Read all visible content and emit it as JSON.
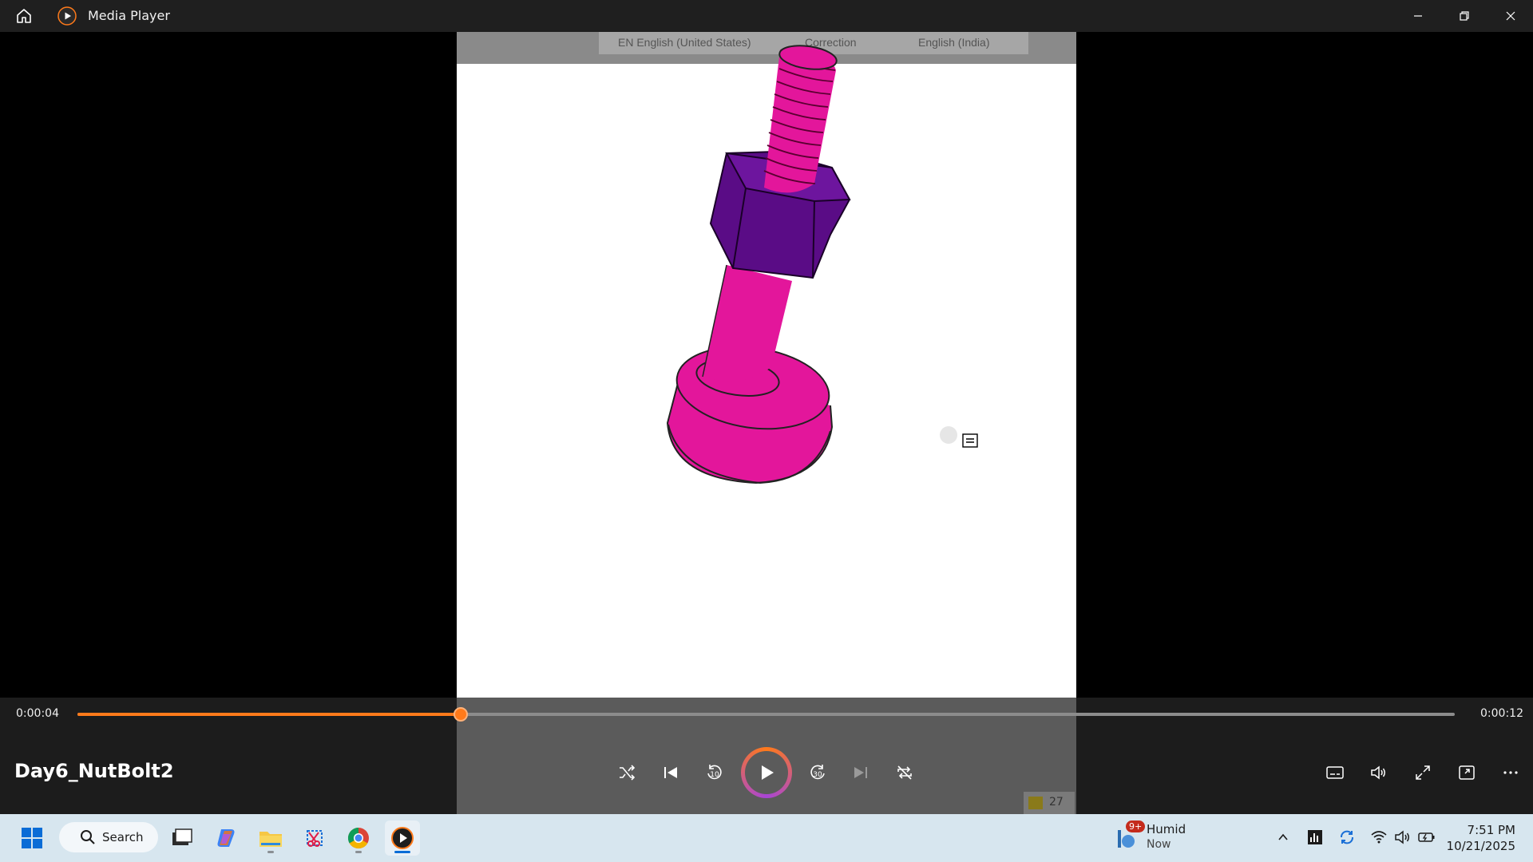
{
  "window": {
    "title": "Media Player",
    "accent": "#ff7a1a"
  },
  "video_overlay": {
    "language_bar": [
      "EN English (United States)",
      "Correction",
      "English (India)"
    ]
  },
  "playback": {
    "current_time": "0:00:04",
    "total_time": "0:00:12",
    "progress_fraction": 0.278,
    "title": "Day6_NutBolt2",
    "state": "paused",
    "badge_value": "27"
  },
  "icons": {
    "controls": [
      "shuffle-icon",
      "previous-icon",
      "rewind-10-icon",
      "play-icon",
      "forward-30-icon",
      "next-icon",
      "repeat-icon"
    ],
    "right_controls": [
      "subtitles-icon",
      "volume-icon",
      "fullscreen-icon",
      "miniplayer-icon",
      "more-icon"
    ]
  },
  "taskbar": {
    "search_label": "Search",
    "weather": {
      "title": "Humid",
      "subtitle": "Now",
      "badge": "9+"
    },
    "clock": {
      "time": "7:51 PM",
      "date": "10/21/2025"
    }
  }
}
